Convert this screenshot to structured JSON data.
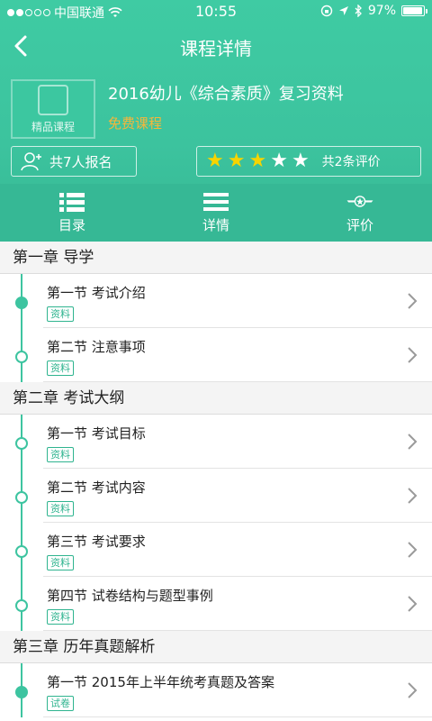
{
  "status_bar": {
    "carrier": "中国联通",
    "time": "10:55",
    "battery": "97%",
    "battery_level": 0.97,
    "signal_dots": [
      true,
      true,
      false,
      false,
      false
    ]
  },
  "nav": {
    "title": "课程详情",
    "back_icon": "chevron-left-icon"
  },
  "course": {
    "thumb_caption": "精品课程",
    "name": "2016幼儿《综合素质》复习资料",
    "price_label": "免费课程"
  },
  "stats": {
    "enroll_text": "共7人报名",
    "rating_stars": 3,
    "rating_max": 5,
    "review_text": "共2条评价"
  },
  "tabs": [
    {
      "label": "目录",
      "icon": "list-icon"
    },
    {
      "label": "详情",
      "icon": "menu-lines-icon"
    },
    {
      "label": "评价",
      "icon": "star-wings-icon"
    }
  ],
  "catalog": [
    {
      "title": "第一章 导学",
      "sections": [
        {
          "title": "第一节 考试介绍",
          "tag": "资料",
          "active": true
        },
        {
          "title": "第二节 注意事项",
          "tag": "资料",
          "active": false
        }
      ]
    },
    {
      "title": "第二章 考试大纲",
      "sections": [
        {
          "title": "第一节 考试目标",
          "tag": "资料",
          "active": false
        },
        {
          "title": "第二节 考试内容",
          "tag": "资料",
          "active": false
        },
        {
          "title": "第三节 考试要求",
          "tag": "资料",
          "active": false
        },
        {
          "title": "第四节 试卷结构与题型事例",
          "tag": "资料",
          "active": false
        }
      ]
    },
    {
      "title": "第三章 历年真题解析",
      "sections": [
        {
          "title": "第一节 2015年上半年统考真题及答案",
          "tag": "试卷",
          "active": true
        }
      ]
    }
  ],
  "colors": {
    "primary": "#3cc39e",
    "star_on": "#f7d400",
    "price": "#f6b63a"
  }
}
